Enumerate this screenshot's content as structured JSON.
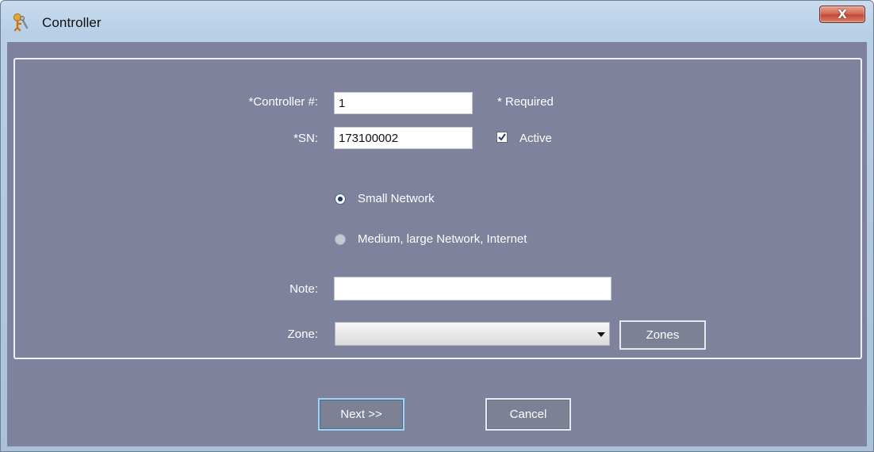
{
  "window": {
    "title": "Controller",
    "close_label": "X",
    "icon": "key-person-icon"
  },
  "form": {
    "controller_label": "*Controller #:",
    "controller_value": "1",
    "required_note": "* Required",
    "sn_label": "*SN:",
    "sn_value": "173100002",
    "active_label": "Active",
    "active_checked": true,
    "network_options": [
      {
        "label": "Small Network",
        "selected": true
      },
      {
        "label": "Medium, large Network, Internet",
        "selected": false
      }
    ],
    "note_label": "Note:",
    "note_value": "",
    "zone_label": "Zone:",
    "zone_value": "",
    "zones_button": "Zones"
  },
  "footer": {
    "next_button": "Next >>",
    "cancel_button": "Cancel"
  }
}
